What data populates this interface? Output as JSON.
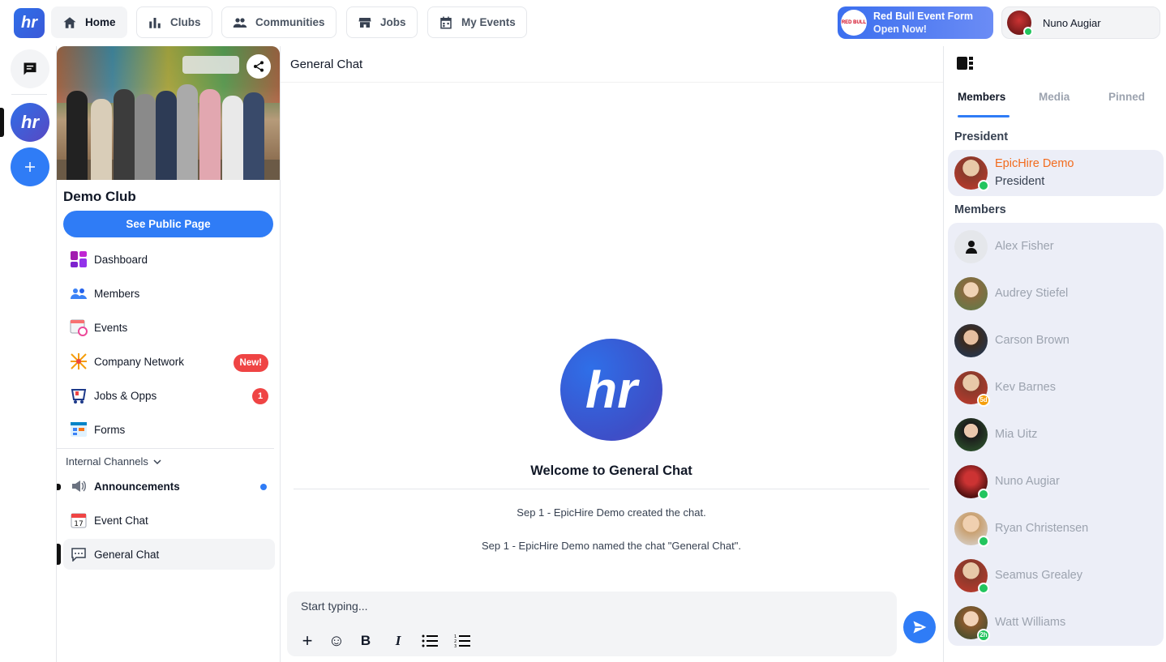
{
  "topbar": {
    "logo_text": "hr",
    "nav": [
      {
        "label": "Home",
        "icon": "home-icon"
      },
      {
        "label": "Clubs",
        "icon": "bar-chart-icon"
      },
      {
        "label": "Communities",
        "icon": "people-icon"
      },
      {
        "label": "Jobs",
        "icon": "store-icon"
      },
      {
        "label": "My Events",
        "icon": "calendar-icon"
      }
    ],
    "promo": {
      "line1": "Red Bull Event Form",
      "line2": "Open Now!"
    },
    "user": {
      "name": "Nuno Augiar"
    }
  },
  "club": {
    "name": "Demo Club",
    "public_button": "See Public Page",
    "menu": [
      {
        "label": "Dashboard"
      },
      {
        "label": "Members"
      },
      {
        "label": "Events"
      },
      {
        "label": "Company Network",
        "badge": "New!"
      },
      {
        "label": "Jobs & Opps",
        "count": "1"
      },
      {
        "label": "Forms"
      }
    ],
    "channels_header": "Internal Channels",
    "channels": [
      {
        "label": "Announcements",
        "icon": "speaker-icon"
      },
      {
        "label": "Event Chat",
        "icon": "calendar-17-icon"
      },
      {
        "label": "General Chat",
        "icon": "speech-bubble-icon"
      }
    ]
  },
  "chat": {
    "title": "General Chat",
    "logo_text": "hr",
    "welcome": "Welcome to General Chat",
    "messages": [
      "Sep 1 - EpicHire Demo created the chat.",
      "Sep 1 - EpicHire Demo named the chat \"General Chat\"."
    ],
    "composer_placeholder": "Start typing...",
    "tools": [
      "+",
      "☺",
      "B",
      "I"
    ]
  },
  "panel": {
    "tabs": [
      "Members",
      "Media",
      "Pinned"
    ],
    "president_header": "President",
    "president": {
      "name": "EpicHire Demo",
      "role": "President"
    },
    "members_header": "Members",
    "members": [
      {
        "name": "Alex Fisher"
      },
      {
        "name": "Audrey Stiefel"
      },
      {
        "name": "Carson Brown"
      },
      {
        "name": "Kev Barnes",
        "badge": "5d"
      },
      {
        "name": "Mia Uitz"
      },
      {
        "name": "Nuno Augiar",
        "online": true
      },
      {
        "name": "Ryan Christensen",
        "online": true
      },
      {
        "name": "Seamus Grealey",
        "online": true
      },
      {
        "name": "Watt Williams",
        "badge": "2h"
      }
    ]
  },
  "colors": {
    "accent": "#2f7cf6",
    "badge_red": "#ef4444",
    "online": "#22c55e",
    "president_name": "#f26b1d"
  }
}
